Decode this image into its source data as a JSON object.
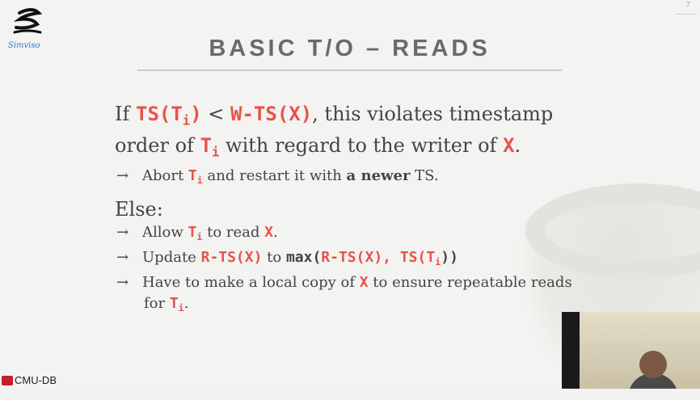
{
  "brand": {
    "logo_text": "Simviso",
    "footer": "CMU-DB"
  },
  "page_number": "7",
  "title": "BASIC T/O – READS",
  "content": {
    "line1": {
      "if": "If ",
      "ts": "TS(T",
      "i": "i",
      "close": ")",
      "lt": " < ",
      "wts": "W-TS(X)",
      "rest": ", this violates timestamp"
    },
    "line2": {
      "a": "order of ",
      "t": "T",
      "i": "i",
      "b": " with regard to the writer of ",
      "x": "X",
      "c": "."
    },
    "line3": {
      "a": "Abort ",
      "t": "T",
      "i": "i",
      "b": " and restart it with ",
      "bold": "a newer",
      "c": " TS."
    },
    "else": "Else:",
    "b1": {
      "a": "Allow ",
      "t": "T",
      "i": "i",
      "b": " to read ",
      "x": "X",
      "c": "."
    },
    "b2": {
      "a": "Update ",
      "rts": "R-TS(X)",
      "b": " to ",
      "max": "max(",
      "rts2": "R-TS(X), TS(T",
      "i": "i",
      "close": "))"
    },
    "b3": {
      "a": "Have to make a local copy of ",
      "x": "X",
      "b": " to ensure repeatable reads"
    },
    "b3b": {
      "a": "for ",
      "t": "T",
      "i": "i",
      "c": "."
    },
    "arrow": "→"
  }
}
